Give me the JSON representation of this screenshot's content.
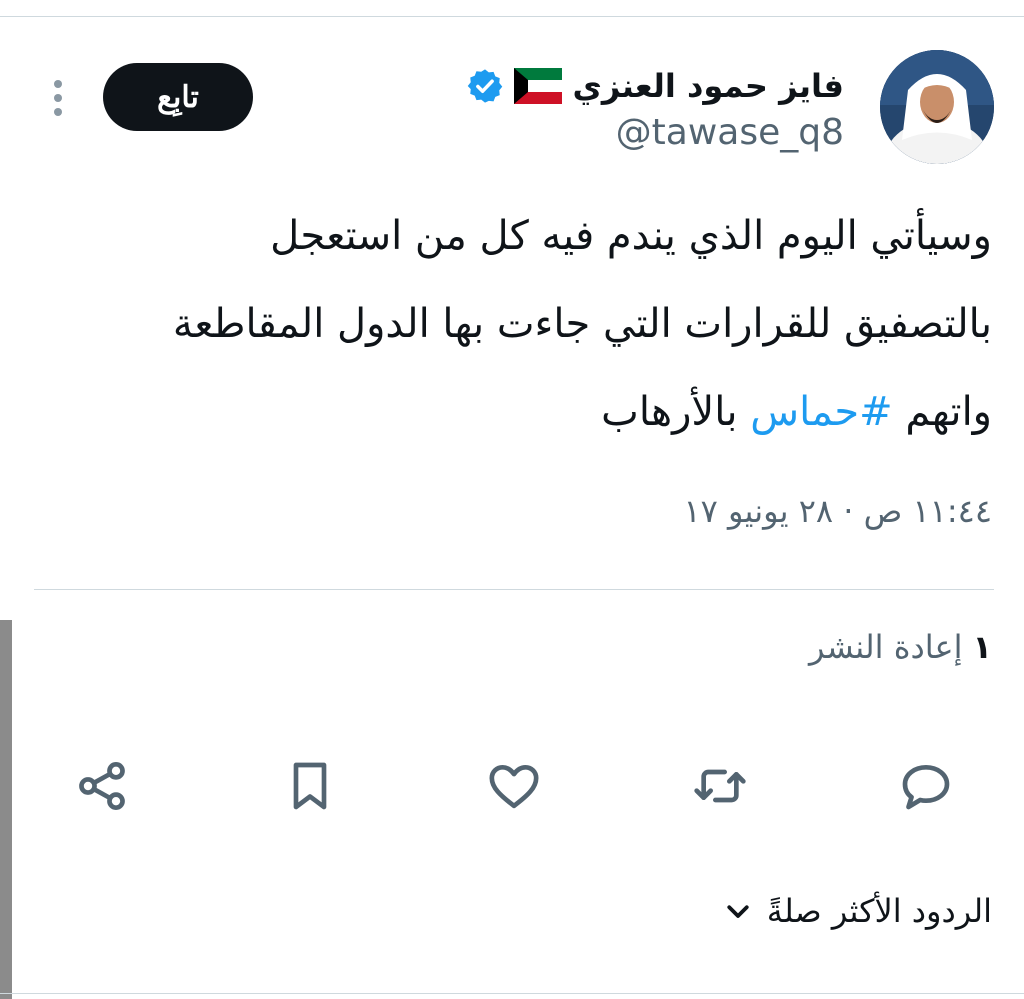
{
  "author": {
    "name": "فايز حمود العنزي",
    "handle": "@tawase_q8",
    "flag_icon": "kuwait-flag-icon",
    "verified_icon": "verified-badge-icon"
  },
  "follow_label": "تابِع",
  "tweet": {
    "line1": "وسيأتي اليوم الذي يندم فيه كل من استعجل",
    "line2": "بالتصفيق للقرارات التي جاءت بها الدول المقاطعة",
    "line3_prefix": "واتهم",
    "hashtag": "#حماس",
    "line3_suffix": "بالأرهاب"
  },
  "timestamp": "١١:٤٤ ص · ٢٨ يونيو ١٧",
  "stats": {
    "retweets_count": "١",
    "retweets_label": "إعادة النشر"
  },
  "actions": [
    "reply-icon",
    "retweet-icon",
    "like-icon",
    "bookmark-icon",
    "share-icon"
  ],
  "replies_sort": {
    "label": "الردود الأكثر صلةً"
  },
  "colors": {
    "hashtag": "#1d9bf0",
    "secondary_text": "#536471",
    "primary_text": "#0f1419",
    "verified": "#1d9bf0"
  }
}
